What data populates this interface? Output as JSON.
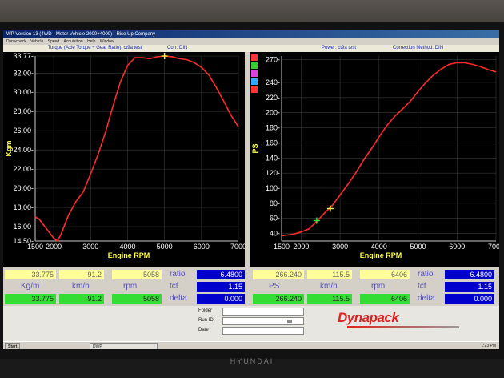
{
  "window": {
    "title": "WP Version 13 (4WD - Motor Vehicle 2000+4000) - Rise Up Company",
    "menu": [
      "Dynacheck",
      "Vehicle",
      "Speed",
      "Acquisition",
      "Help",
      "Window"
    ]
  },
  "info": {
    "left_title": "Torque (Axle Torque ÷ Gear Ratio): ct9a test",
    "left_corr": "Corr: DIN",
    "right_power": "Power: ct9a test",
    "right_corr": "Correction Method: DIN"
  },
  "chart_data": [
    {
      "type": "line",
      "ylabel": "Kgm",
      "xlabel": "Engine RPM",
      "xlim": [
        1500,
        7000
      ],
      "ylim": [
        14.5,
        33.775
      ],
      "x_ticks": [
        "1500",
        "2000",
        "3000",
        "4000",
        "5000",
        "6000",
        "7000"
      ],
      "y_ticks": [
        "33.77-",
        "32.00-",
        "30.00-",
        "28.00-",
        "26.00-",
        "24.00-",
        "22.00-",
        "20.00-",
        "18.00-",
        "16.00-",
        "14.50-"
      ],
      "y_tick_values": [
        33.775,
        32,
        30,
        28,
        26,
        24,
        22,
        20,
        18,
        16,
        14.5
      ],
      "series": [
        {
          "color": "#ff2a2a",
          "x": [
            1500,
            1600,
            1800,
            2000,
            2100,
            2200,
            2400,
            2600,
            2800,
            3000,
            3200,
            3400,
            3600,
            3800,
            4000,
            4200,
            4400,
            4600,
            4800,
            5000,
            5200,
            5400,
            5600,
            5800,
            6000,
            6200,
            6400,
            6600,
            6800,
            7000
          ],
          "y": [
            17.0,
            16.8,
            15.8,
            14.8,
            14.5,
            15.2,
            17.2,
            18.6,
            19.6,
            21.5,
            23.5,
            25.8,
            28.5,
            31.0,
            32.8,
            33.6,
            33.6,
            33.5,
            33.7,
            33.775,
            33.7,
            33.5,
            33.4,
            33.1,
            32.6,
            31.8,
            30.5,
            29.1,
            27.6,
            26.4
          ]
        }
      ],
      "marker": {
        "x": 5000,
        "y": 33.775,
        "color": "#ffee44"
      }
    },
    {
      "type": "line",
      "ylabel": "PS",
      "xlabel": "Engine RPM",
      "xlim": [
        1500,
        7000
      ],
      "ylim": [
        30,
        275
      ],
      "x_ticks": [
        "1500",
        "2000",
        "3000",
        "4000",
        "5000",
        "6000",
        "7000"
      ],
      "y_ticks": [
        "270-",
        "240-",
        "220-",
        "200-",
        "180-",
        "160-",
        "140-",
        "120-",
        "100-",
        "80-",
        "60-",
        "40-"
      ],
      "y_tick_values": [
        270,
        240,
        220,
        200,
        180,
        160,
        140,
        120,
        100,
        80,
        60,
        40
      ],
      "series": [
        {
          "color": "#ff2a2a",
          "x": [
            1500,
            1800,
            2000,
            2200,
            2400,
            2600,
            2800,
            3000,
            3200,
            3400,
            3600,
            3800,
            4000,
            4200,
            4400,
            4600,
            4800,
            5000,
            5200,
            5400,
            5600,
            5800,
            6000,
            6200,
            6400,
            6600,
            6800,
            7000
          ],
          "y": [
            37,
            39,
            42,
            46,
            56,
            67,
            77,
            91,
            105,
            120,
            137,
            152,
            168,
            183,
            195,
            205,
            215,
            228,
            240,
            250,
            258,
            264,
            266.24,
            266,
            264,
            261,
            257,
            254
          ]
        }
      ],
      "markers": [
        {
          "x": 2400,
          "y": 57,
          "color": "#33ee33"
        },
        {
          "x": 2750,
          "y": 73,
          "color": "#ffee44"
        }
      ],
      "legend_colors": [
        "#ff3333",
        "#33cc33",
        "#dd44dd",
        "#33aaff",
        "#ff3333"
      ]
    }
  ],
  "readouts": {
    "left": {
      "yellow": [
        "33.775",
        "91.2",
        "5058"
      ],
      "units": [
        "Kg/m",
        "km/h",
        "rpm"
      ],
      "green": [
        "33.775",
        "91.2",
        "5058"
      ],
      "ratio_label": "ratio",
      "ratio_value": "6.4800",
      "tcf_label": "tcf",
      "tcf_value": "1.15",
      "delta_label": "delta",
      "delta_value": "0.000"
    },
    "right": {
      "yellow": [
        "266.240",
        "115.5",
        "6406"
      ],
      "units": [
        "PS",
        "km/h",
        "rpm"
      ],
      "green": [
        "266.240",
        "115.5",
        "6406"
      ],
      "ratio_label": "ratio",
      "ratio_value": "6.4800",
      "tcf_label": "tcf",
      "tcf_value": "1.15",
      "delta_label": "delta",
      "delta_value": "0.000"
    }
  },
  "bottom": {
    "folder_label": "Folder",
    "runid_label": "Run ID",
    "date_label": "Date",
    "logo": "Dynapack"
  },
  "taskbar": {
    "start": "Start",
    "task": "DWP",
    "time": "1:23 PM"
  },
  "monitor_brand": "HYUNDAI"
}
